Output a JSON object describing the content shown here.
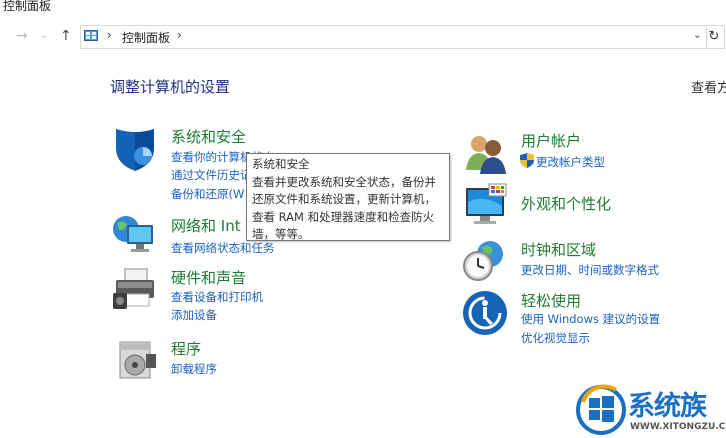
{
  "window": {
    "title": "控制面板"
  },
  "nav": {
    "back_icon": "arrow-left-icon",
    "forward_icon": "chevron-down-icon",
    "up_icon": "arrow-up-icon",
    "breadcrumb": "控制面板",
    "refresh_icon": "refresh-icon"
  },
  "main": {
    "heading": "调整计算机的设置",
    "view_by": "查看方"
  },
  "categories": [
    {
      "title": "系统和安全",
      "links": [
        "查看你的计算机状态",
        "通过文件历史记",
        "备份和还原(W"
      ]
    },
    {
      "title": "网络和 Int",
      "links": [
        "查看网络状态和任务"
      ]
    },
    {
      "title": "硬件和声音",
      "links": [
        "查看设备和打印机",
        "添加设备"
      ]
    },
    {
      "title": "程序",
      "links": [
        "卸载程序"
      ]
    },
    {
      "title": "用户帐户",
      "links": [
        "更改帐户类型"
      ]
    },
    {
      "title": "外观和个性化",
      "links": []
    },
    {
      "title": "时钟和区域",
      "links": [
        "更改日期、时间或数字格式"
      ]
    },
    {
      "title": "轻松使用",
      "links": [
        "使用 Windows 建议的设置",
        "优化视觉显示"
      ]
    }
  ],
  "tooltip": {
    "lines": [
      "系统和安全",
      "查看并更改系统和安全状态，备份并",
      "还原文件和系统设置，更新计算机，",
      "查看 RAM 和处理器速度和检查防火",
      "墙，等等。"
    ]
  },
  "watermark": {
    "text": "系统族",
    "url": "WWW.XITONGZU.COM"
  },
  "colors": {
    "heading": "#1e3287",
    "category_title": "#1e7d32",
    "link": "#1a63c3"
  }
}
